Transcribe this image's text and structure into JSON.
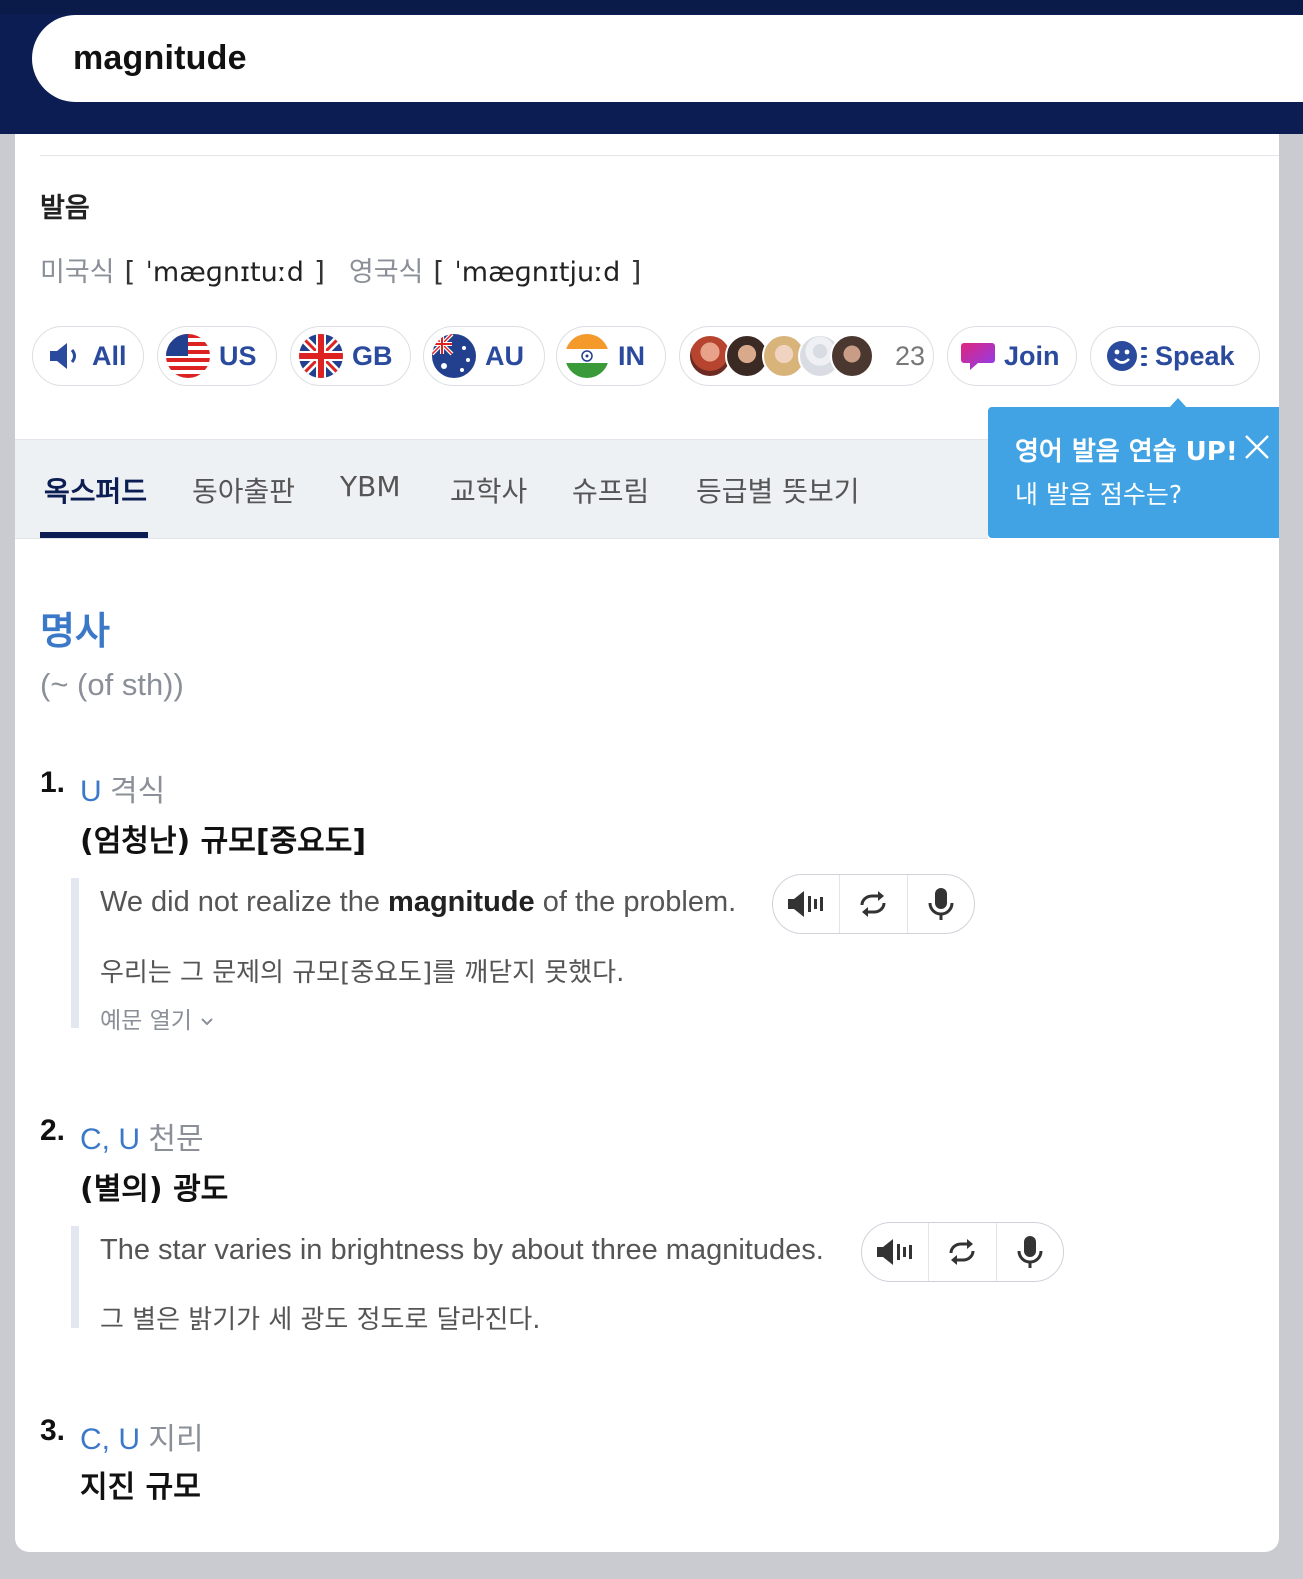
{
  "search": {
    "query": "magnitude"
  },
  "pronunciation": {
    "title": "발음",
    "us_label": "미국식",
    "us_ipa": "ˈmæɡnɪtuːd",
    "uk_label": "영국식",
    "uk_ipa": "ˈmæɡnɪtjuːd",
    "open_bracket": "[",
    "close_bracket": "]"
  },
  "accent_buttons": [
    {
      "label": "All",
      "icon": "speaker-icon"
    },
    {
      "label": "US",
      "icon": "us-flag-icon"
    },
    {
      "label": "GB",
      "icon": "gb-flag-icon"
    },
    {
      "label": "AU",
      "icon": "au-flag-icon"
    },
    {
      "label": "IN",
      "icon": "in-flag-icon"
    }
  ],
  "community": {
    "count": "23"
  },
  "join": {
    "label": "Join"
  },
  "speak": {
    "label": "Speak"
  },
  "tooltip": {
    "line1": "영어 발음 연습 UP!",
    "line2": "내 발음 점수는?"
  },
  "tabs": [
    "옥스퍼드",
    "동아출판",
    "YBM",
    "교학사",
    "슈프림",
    "등급별 뜻보기"
  ],
  "entry": {
    "pos": "명사",
    "pattern": "(~ (of sth))",
    "senses": [
      {
        "num": "1.",
        "gram": "U",
        "field": "격식",
        "def": "(엄청난) 규모[중요도]",
        "example_en_before": "We did not realize the",
        "example_en_bold": "magnitude",
        "example_en_after": "of the problem.",
        "example_ko": "우리는 그 문제의 규모[중요도]를 깨닫지 못했다.",
        "more": "예문 열기"
      },
      {
        "num": "2.",
        "gram": "C, U",
        "field": "천문",
        "def": "(별의) 광도",
        "example_en": "The star varies in brightness by about three magnitudes.",
        "example_ko": "그 별은 밝기가 세 광도 정도로 달라진다."
      },
      {
        "num": "3.",
        "gram": "C, U",
        "field": "지리",
        "def": "지진 규모"
      }
    ]
  },
  "colors": {
    "header": "#0b1d52",
    "accent_blue": "#3c78c8",
    "tooltip": "#41a3e3",
    "pill_text": "#2a4a9e"
  }
}
